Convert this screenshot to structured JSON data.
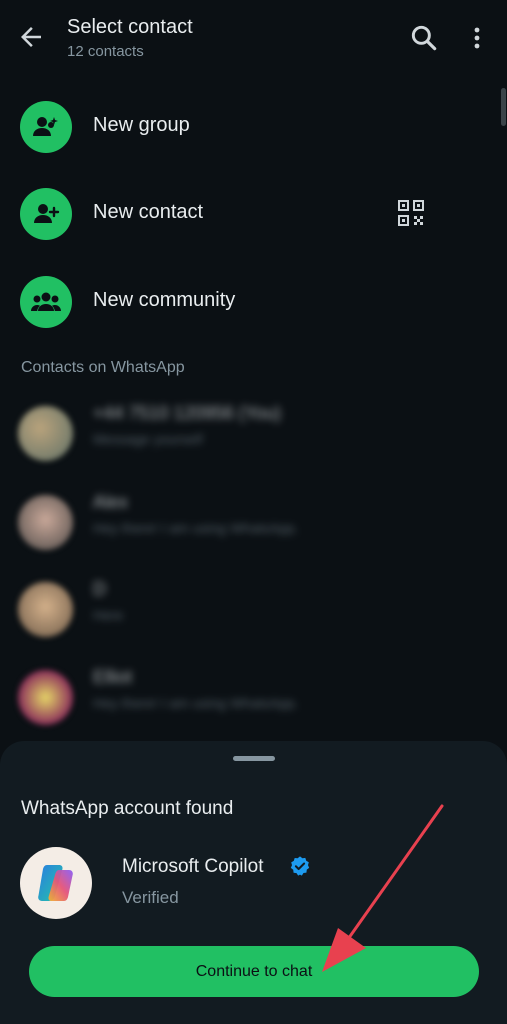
{
  "header": {
    "title": "Select contact",
    "subtitle": "12 contacts",
    "icons": [
      "back-arrow-icon",
      "search-icon",
      "more-vert-icon"
    ]
  },
  "actions": [
    {
      "label": "New group",
      "icon": "group-add-icon"
    },
    {
      "label": "New contact",
      "icon": "person-add-icon",
      "trailing_icon": "qr-code-icon"
    },
    {
      "label": "New community",
      "icon": "community-icon"
    }
  ],
  "contacts_section": {
    "heading": "Contacts on WhatsApp",
    "items": [
      {
        "name": "+44 7510 120956 (You)",
        "status": "Message yourself"
      },
      {
        "name": "Alex",
        "status": "Hey there! I am using WhatsApp."
      },
      {
        "name": "D",
        "status": "Here"
      },
      {
        "name": "Elliot",
        "status": "Hey there! I am using WhatsApp."
      }
    ]
  },
  "sheet": {
    "heading": "WhatsApp account found",
    "account_name": "Microsoft Copilot",
    "account_status": "Verified",
    "button_label": "Continue to chat"
  },
  "colors": {
    "background": "#0b1014",
    "sheet": "#121b21",
    "accent": "#21c063",
    "verified": "#1d9bf0",
    "annotation_arrow": "#e8414f"
  }
}
